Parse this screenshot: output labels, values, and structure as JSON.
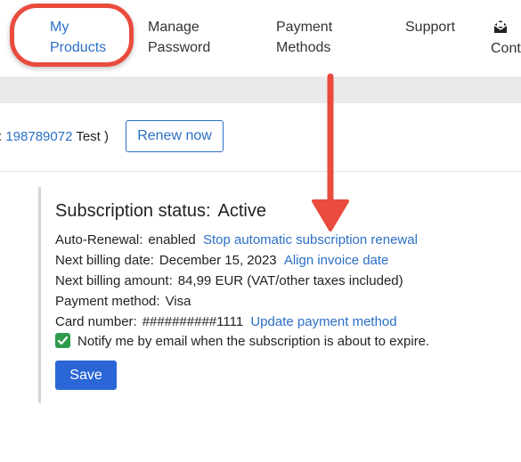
{
  "nav": {
    "my_products": [
      "My",
      "Products"
    ],
    "manage_password": [
      "Manage",
      "Password"
    ],
    "payment_methods": [
      "Payment",
      "Methods"
    ],
    "support": "Support",
    "contact": "Cont"
  },
  "product": {
    "id_prefix": ": ",
    "id_link": "198789072",
    "id_suffix": " Test )",
    "renew_label": "Renew now"
  },
  "subscription": {
    "status_label": "Subscription status:",
    "status_value": "Active",
    "auto_renewal_label": "Auto-Renewal:",
    "auto_renewal_value": "enabled",
    "auto_renewal_link": "Stop automatic subscription renewal",
    "next_billing_date_label": "Next billing date:",
    "next_billing_date_value": "December 15, 2023",
    "next_billing_date_link": "Align invoice date",
    "next_billing_amount_label": "Next billing amount:",
    "next_billing_amount_value": "84,99 EUR (VAT/other taxes included)",
    "payment_method_label": "Payment method:",
    "payment_method_value": "Visa",
    "card_number_label": "Card number:",
    "card_number_value": "##########1111",
    "card_number_link": "Update payment method",
    "notify_label": "Notify me by email when the subscription is about to expire.",
    "notify_checked": true,
    "save_label": "Save"
  },
  "colors": {
    "accent": "#2b6fc6",
    "save_button": "#2a66d6",
    "checkbox": "#2e9b4d",
    "annotation": "#e94b3c"
  },
  "icons": {
    "contact": "envelope-icon",
    "check": "checkmark-icon"
  }
}
